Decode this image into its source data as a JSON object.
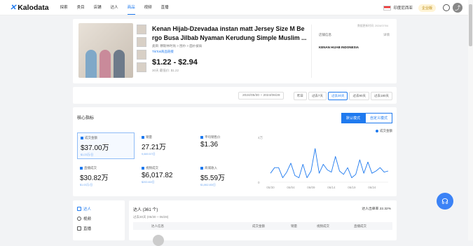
{
  "app": {
    "logo_text": "Kalodata",
    "accent": "#1f7aef"
  },
  "nav": [
    "探索",
    "类目",
    "店铺",
    "达人",
    "商品",
    "视频",
    "直播"
  ],
  "nav_active_index": 4,
  "topbar": {
    "region": "印度尼西亚",
    "vip_label": "企业版"
  },
  "product": {
    "title": "Kenan Hijab-Dzevadaa instan matt Jersey Size M Be rgo Busa Jilbab Nyaman Kerudung Simple Muslim ...",
    "category": "类目: 穆斯林时尚 > 围巾 > 面纱披肩",
    "link_label": "TikTok商品链接",
    "price_range": "$1.22 - $2.94",
    "avg_price": "30天 最低价: $1.22",
    "updated": "数据更新时间: 2024/07/04",
    "shop_label": "店铺信息",
    "shop_link": "详情",
    "shop_name": "KENAN HIJAB INDONESIA"
  },
  "datebar": {
    "range": "2024/05/30 ~ 2024/06/28",
    "buttons": [
      "昨日",
      "过去7天",
      "过去30天",
      "过去90天",
      "过去180天"
    ],
    "selected_index": 2
  },
  "metrics": {
    "title": "核心指标",
    "modes": [
      "默认模式",
      "自定义模式"
    ],
    "kpis": [
      {
        "label": "成交金额",
        "value": "$37.00万",
        "sub": "$1.23万/日"
      },
      {
        "label": "销量",
        "value": "27.21万",
        "sub": "9,069.57/日"
      },
      {
        "label": "平均销售价",
        "value": "$1.36",
        "sub": ""
      },
      {
        "label": "直播成交",
        "value": "$30.82万",
        "sub": "$1.03万/日"
      },
      {
        "label": "视频成交",
        "value": "$6,017.82",
        "sub": "$200.60/日"
      },
      {
        "label": "商城收入",
        "value": "$5.59万",
        "sub": "$1,862.83/日"
      }
    ],
    "legend": "成交金额"
  },
  "chart_data": {
    "type": "line",
    "series": [
      {
        "name": "成交金额",
        "values": [
          0.8,
          1.3,
          1.3,
          0.4,
          0.9,
          1.7,
          0.6,
          0.4,
          1.6,
          0.4,
          1.0,
          3.0,
          0.8,
          1.6,
          1.1,
          0.9,
          2.3,
          1.0,
          0.7,
          1.3,
          0.4,
          0.7,
          2.0,
          0.8,
          1.8,
          0.8,
          1.0,
          1.3,
          0.9,
          1.0
        ]
      }
    ],
    "x_labels": [
      "05/30",
      "06/04",
      "06/09",
      "06/14",
      "06/19",
      "06/24"
    ],
    "y_ticks": [
      "0",
      "4万"
    ],
    "ylim": [
      0,
      4
    ],
    "color": "#1f7aef"
  },
  "side": {
    "items": [
      "达人",
      "视频",
      "直播"
    ],
    "active_index": 0
  },
  "bottom": {
    "title": "达人 (361 个)",
    "range": "过去30天 (05/30 ~ 06/28)",
    "ratio": "达人出单率 22.32%",
    "columns": [
      "达人信息",
      "成交金额",
      "销量",
      "视频成交",
      "直播成交"
    ]
  }
}
